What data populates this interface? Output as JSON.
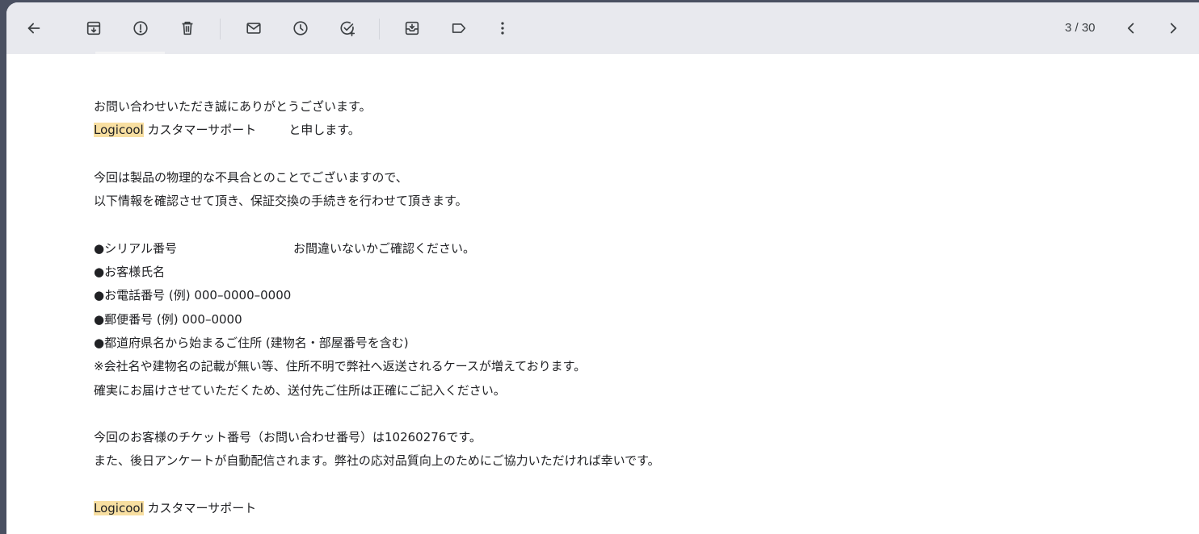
{
  "toolbar": {
    "back_icon": "arrow-left-icon",
    "archive_icon": "archive-icon",
    "report_spam_icon": "report-spam-icon",
    "delete_icon": "trash-icon",
    "mark_unread_icon": "mail-icon",
    "snooze_icon": "clock-icon",
    "add_task_icon": "add-task-icon",
    "move_to_icon": "move-to-inbox-icon",
    "label_icon": "label-icon",
    "more_icon": "more-vert-icon",
    "pager_text": "3 / 30",
    "prev_icon": "chevron-left-icon",
    "next_icon": "chevron-right-icon"
  },
  "email": {
    "highlight_color": "#f8dfa1",
    "greeting": "お問い合わせいただき誠にありがとうございます。",
    "intro_brand": "Logicool",
    "intro_rest": " カスタマーサポート",
    "intro_suffix": "と申します。",
    "para1_line1": "今回は製品の物理的な不具合とのことでございますので、",
    "para1_line2": "以下情報を確認させて頂き、保証交換の手続きを行わせて頂きます。",
    "item_serial": "●シリアル番号",
    "item_serial_note": "お間違いないかご確認ください。",
    "item_name": "●お客様氏名",
    "item_phone": "●お電話番号 (例) 000–0000–0000",
    "item_postal": "●郵便番号 (例) 000–0000",
    "item_address": "●都道府県名から始まるご住所 (建物名・部屋番号を含む)",
    "note_line1": "※会社名や建物名の記載が無い等、住所不明で弊社へ返送されるケースが増えております。",
    "note_line2": "確実にお届けさせていただくため、送付先ご住所は正確にご記入ください。",
    "ticket_line": "今回のお客様のチケット番号（お問い合わせ番号）は10260276です。",
    "survey_line": "また、後日アンケートが自動配信されます。弊社の応対品質向上のためにご協力いただければ幸いです。",
    "sign_brand": "Logicool",
    "sign_rest": " カスタマーサポート"
  }
}
